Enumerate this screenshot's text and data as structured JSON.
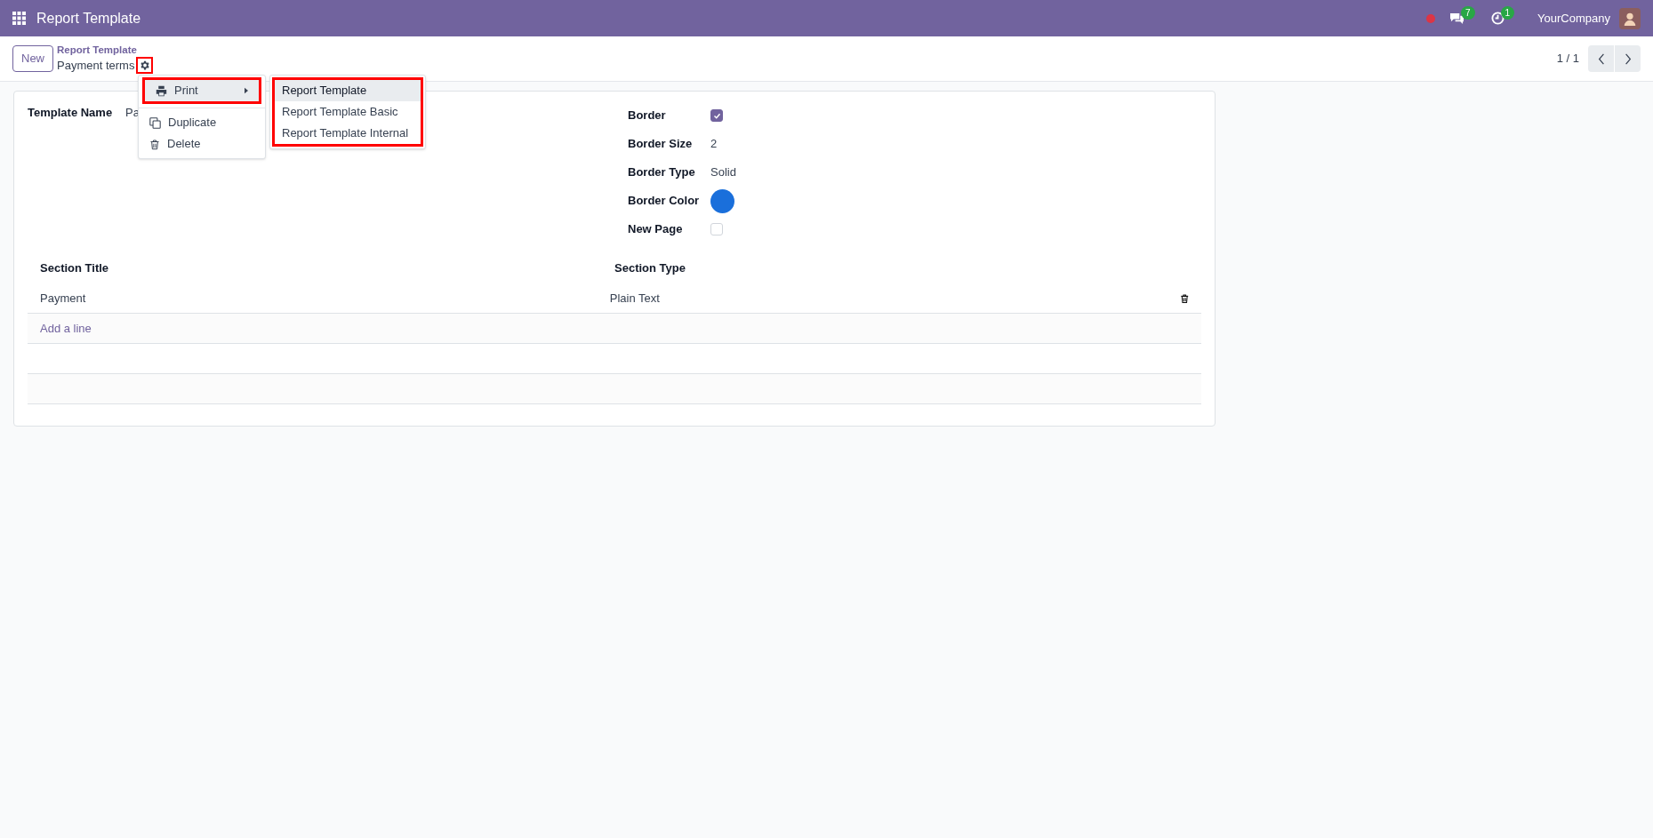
{
  "navbar": {
    "app_title": "Report Template",
    "messages_badge": "7",
    "activities_badge": "1",
    "company": "YourCompany"
  },
  "control_panel": {
    "new_button": "New",
    "breadcrumb_parent": "Report Template",
    "breadcrumb_current": "Payment terms",
    "gear_highlighted": true,
    "pager": "1 / 1"
  },
  "action_menu": {
    "items": [
      {
        "kind": "submenu",
        "label": "Print",
        "highlighted": true
      },
      {
        "kind": "divider"
      },
      {
        "kind": "duplicate",
        "label": "Duplicate",
        "highlighted": false
      },
      {
        "kind": "delete",
        "label": "Delete",
        "highlighted": false
      }
    ],
    "submenu": {
      "highlighted": true,
      "items": [
        {
          "label": "Report Template",
          "selected": true
        },
        {
          "label": "Report Template Basic",
          "selected": false
        },
        {
          "label": "Report Template Internal",
          "selected": false
        }
      ]
    }
  },
  "form": {
    "left_fields": [
      {
        "kind": "text",
        "label": "Template Name",
        "value": "Pa"
      }
    ],
    "right_fields": [
      {
        "kind": "checkbox",
        "label": "Border",
        "checked": true
      },
      {
        "kind": "text",
        "label": "Border Size",
        "value": "2"
      },
      {
        "kind": "text",
        "label": "Border Type",
        "value": "Solid"
      },
      {
        "kind": "color",
        "label": "Border Color",
        "color": "#1a6fdb"
      },
      {
        "kind": "checkbox",
        "label": "New Page",
        "checked": false
      }
    ]
  },
  "table": {
    "columns": [
      "Section Title",
      "Section Type"
    ],
    "rows": [
      {
        "cells": [
          "Payment",
          "Plain Text"
        ]
      }
    ],
    "add_line": "Add a line"
  }
}
